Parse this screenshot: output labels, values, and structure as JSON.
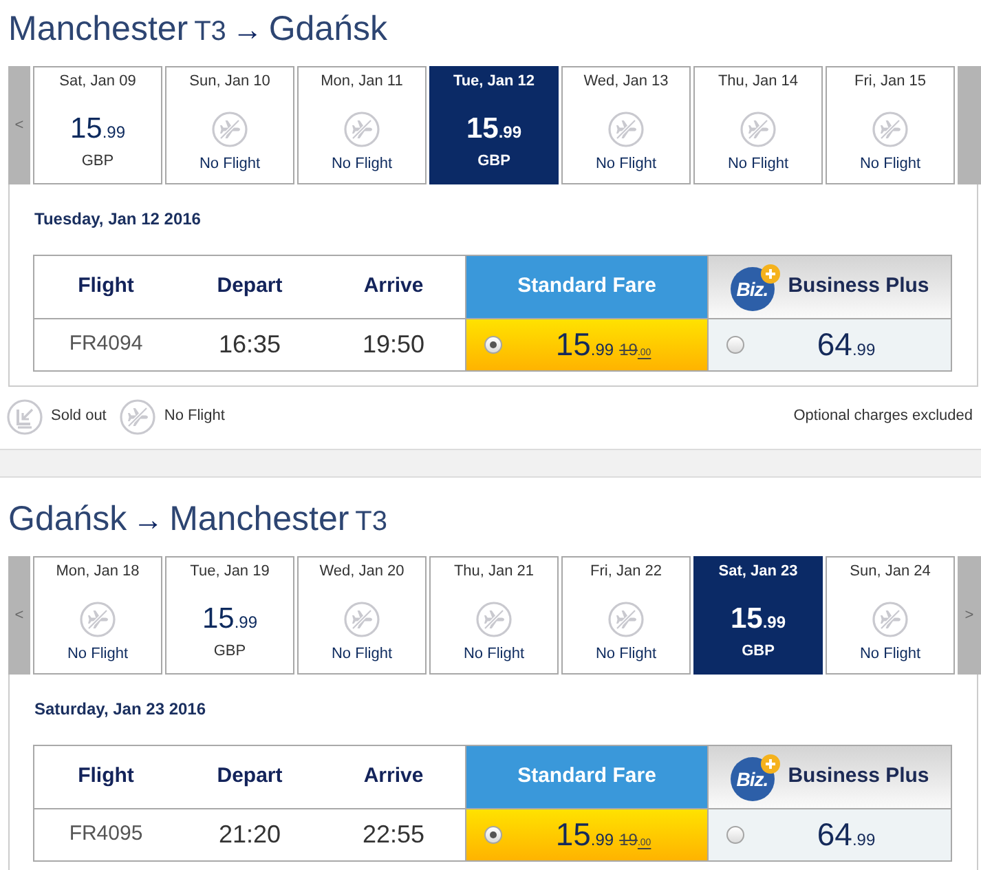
{
  "journeys": [
    {
      "route": [
        {
          "kind": "city",
          "text": "Manchester"
        },
        {
          "kind": "terminal",
          "text": "T3"
        },
        {
          "kind": "arrow",
          "text": "→"
        },
        {
          "kind": "city",
          "text": "Gdańsk"
        }
      ],
      "date_strip": {
        "prev": "<",
        "days": [
          {
            "kind": "fare",
            "date": "Sat, Jan 09",
            "price": {
              "whole": "15",
              "fraction": ".99"
            },
            "currency": "GBP",
            "selected": false
          },
          {
            "kind": "no_flight",
            "date": "Sun, Jan 10",
            "label": "No Flight",
            "selected": false
          },
          {
            "kind": "no_flight",
            "date": "Mon, Jan 11",
            "label": "No Flight",
            "selected": false
          },
          {
            "kind": "fare",
            "date": "Tue, Jan 12",
            "price": {
              "whole": "15",
              "fraction": ".99"
            },
            "currency": "GBP",
            "selected": true
          },
          {
            "kind": "no_flight",
            "date": "Wed, Jan 13",
            "label": "No Flight",
            "selected": false
          },
          {
            "kind": "no_flight",
            "date": "Thu, Jan 14",
            "label": "No Flight",
            "selected": false
          },
          {
            "kind": "no_flight",
            "date": "Fri, Jan 15",
            "label": "No Flight",
            "selected": false
          }
        ]
      },
      "selected_date": "Tuesday, Jan 12 2016",
      "fare_table": {
        "columns": [
          "Flight",
          "Depart",
          "Arrive"
        ],
        "fare_columns": [
          {
            "kind": "standard",
            "label": "Standard Fare"
          },
          {
            "kind": "business",
            "badge": "Biz.",
            "label": "Business Plus"
          }
        ],
        "rows": [
          {
            "flight": "FR4094",
            "depart": "16:35",
            "arrive": "19:50",
            "fares": [
              {
                "price": {
                  "whole": "15",
                  "fraction": ".99"
                },
                "was": {
                  "whole": "19",
                  "fraction": ".00"
                },
                "selected": true
              },
              {
                "price": {
                  "whole": "64",
                  "fraction": ".99"
                },
                "selected": false
              }
            ]
          }
        ]
      },
      "legend": [
        {
          "kind": "sold_out",
          "label": "Sold out"
        },
        {
          "kind": "no_flight",
          "label": "No Flight"
        }
      ],
      "note": "Optional charges excluded"
    },
    {
      "route": [
        {
          "kind": "city",
          "text": "Gdańsk"
        },
        {
          "kind": "arrow",
          "text": "→"
        },
        {
          "kind": "city",
          "text": "Manchester"
        },
        {
          "kind": "terminal",
          "text": "T3"
        }
      ],
      "date_strip": {
        "prev": "<",
        "next": ">",
        "days": [
          {
            "kind": "no_flight",
            "date": "Mon, Jan 18",
            "label": "No Flight",
            "selected": false
          },
          {
            "kind": "fare",
            "date": "Tue, Jan 19",
            "price": {
              "whole": "15",
              "fraction": ".99"
            },
            "currency": "GBP",
            "selected": false
          },
          {
            "kind": "no_flight",
            "date": "Wed, Jan 20",
            "label": "No Flight",
            "selected": false
          },
          {
            "kind": "no_flight",
            "date": "Thu, Jan 21",
            "label": "No Flight",
            "selected": false
          },
          {
            "kind": "no_flight",
            "date": "Fri, Jan 22",
            "label": "No Flight",
            "selected": false
          },
          {
            "kind": "fare",
            "date": "Sat, Jan 23",
            "price": {
              "whole": "15",
              "fraction": ".99"
            },
            "currency": "GBP",
            "selected": true
          },
          {
            "kind": "no_flight",
            "date": "Sun, Jan 24",
            "label": "No Flight",
            "selected": false
          }
        ]
      },
      "selected_date": "Saturday, Jan 23 2016",
      "fare_table": {
        "columns": [
          "Flight",
          "Depart",
          "Arrive"
        ],
        "fare_columns": [
          {
            "kind": "standard",
            "label": "Standard Fare"
          },
          {
            "kind": "business",
            "badge": "Biz.",
            "label": "Business Plus"
          }
        ],
        "rows": [
          {
            "flight": "FR4095",
            "depart": "21:20",
            "arrive": "22:55",
            "fares": [
              {
                "price": {
                  "whole": "15",
                  "fraction": ".99"
                },
                "was": {
                  "whole": "19",
                  "fraction": ".00"
                },
                "selected": true
              },
              {
                "price": {
                  "whole": "64",
                  "fraction": ".99"
                },
                "selected": false
              }
            ]
          }
        ]
      }
    }
  ]
}
